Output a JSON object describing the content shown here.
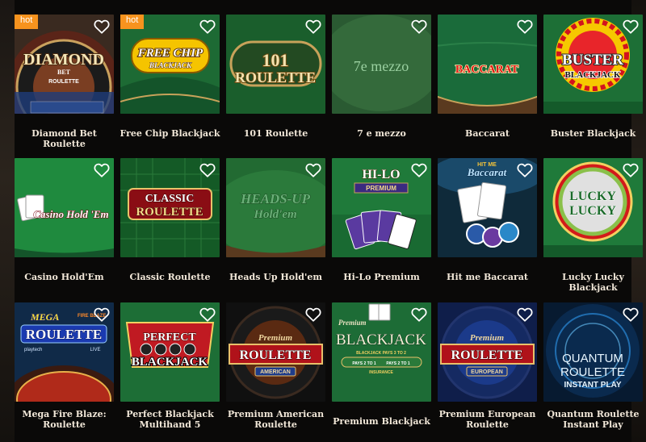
{
  "badge_hot": "hot",
  "games": [
    {
      "title": "Diamond Bet Roulette",
      "hot": true,
      "logo": [
        "DIAMOND",
        "BET",
        "ROULETTE"
      ]
    },
    {
      "title": "Free Chip Blackjack",
      "hot": true,
      "logo": [
        "FREE CHIP",
        "BLACKJACK"
      ]
    },
    {
      "title": "101 Roulette",
      "hot": false,
      "logo": [
        "101",
        "ROULETTE"
      ]
    },
    {
      "title": "7 e mezzo",
      "hot": false,
      "logo": [
        "7e mezzo"
      ]
    },
    {
      "title": "Baccarat",
      "hot": false,
      "logo": [
        "BACCARAT"
      ]
    },
    {
      "title": "Buster Blackjack",
      "hot": false,
      "logo": [
        "BUSTER",
        "BLACKJACK"
      ]
    },
    {
      "title": "Casino Hold'Em",
      "hot": false,
      "logo": [
        "Casino Hold 'Em"
      ]
    },
    {
      "title": "Classic Roulette",
      "hot": false,
      "logo": [
        "CLASSIC",
        "ROULETTE"
      ]
    },
    {
      "title": "Heads Up Hold'em",
      "hot": false,
      "logo": [
        "HEADS-UP",
        "Hold'em"
      ]
    },
    {
      "title": "Hi-Lo Premium",
      "hot": false,
      "logo": [
        "HI-LO",
        "PREMIUM"
      ]
    },
    {
      "title": "Hit me Baccarat",
      "hot": false,
      "logo": [
        "HIT ME",
        "Baccarat"
      ]
    },
    {
      "title": "Lucky Lucky Blackjack",
      "hot": false,
      "logo": [
        "LUCKY",
        "LUCKY"
      ]
    },
    {
      "title": "Mega Fire Blaze: Roulette",
      "hot": false,
      "logo": [
        "MEGA",
        "FIRE BLAZE",
        "ROULETTE",
        "playtech",
        "LIVE"
      ]
    },
    {
      "title": "Perfect Blackjack Multihand 5",
      "hot": false,
      "logo": [
        "PERFECT",
        "BLACKJACK"
      ]
    },
    {
      "title": "Premium American Roulette",
      "hot": false,
      "logo": [
        "Premium",
        "ROULETTE",
        "AMERICAN"
      ]
    },
    {
      "title": "Premium Blackjack",
      "hot": false,
      "logo": [
        "Premium",
        "BLACKJACK",
        "BLACKJACK PAYS 3 TO 2",
        "PAYS 2 TO 1",
        "INSURANCE",
        "PAYS 2 TO 1"
      ]
    },
    {
      "title": "Premium European Roulette",
      "hot": false,
      "logo": [
        "Premium",
        "ROULETTE",
        "EUROPEAN"
      ]
    },
    {
      "title": "Quantum Roulette Instant Play",
      "hot": false,
      "logo": [
        "QUANTUM",
        "ROULETTE",
        "INSTANT PLAY"
      ]
    }
  ],
  "colors": {
    "hot_badge": "#f7931e",
    "caption": "#f1e7d8",
    "felt": "#1f7a3a",
    "background": "#0a0908"
  },
  "icons": {
    "favorite": "heart-outline-icon"
  }
}
